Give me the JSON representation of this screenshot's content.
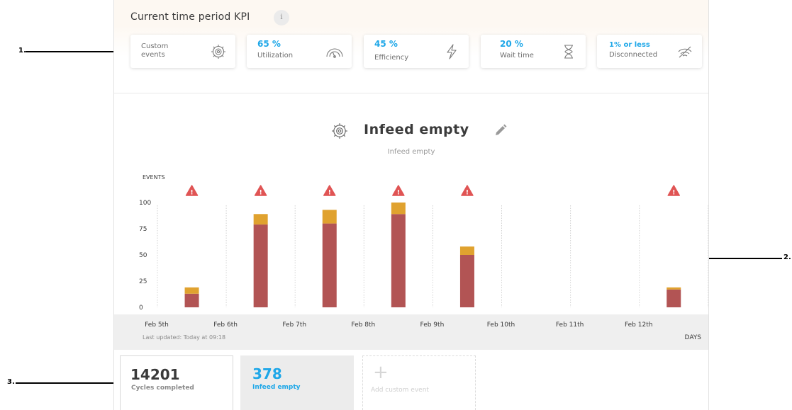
{
  "callouts": [
    "1.",
    "2.",
    "3."
  ],
  "kpi": {
    "title": "Current time period KPI",
    "info_icon": "i",
    "cards": [
      {
        "value": "",
        "label": "Custom\nevents",
        "label_line1": "Custom",
        "label_line2": "events",
        "icon": "gear-icon"
      },
      {
        "value": "65 %",
        "label": "Utilization",
        "icon": "speedometer-icon"
      },
      {
        "value": "45 %",
        "label": "Efficiency",
        "icon": "lightning-icon"
      },
      {
        "value": "20 %",
        "label": "Wait time",
        "icon": "hourglass-icon"
      },
      {
        "value": "1% or less",
        "label": "Disconnected",
        "icon": "disconnected-icon"
      }
    ]
  },
  "event": {
    "title": "Infeed empty",
    "subtitle": "Infeed empty",
    "icon": "gear-icon",
    "edit_icon": "pencil-icon"
  },
  "chart_data": {
    "type": "bar",
    "stacked": true,
    "ylabel": "EVENTS",
    "xlabel": "DAYS",
    "ylim": [
      0,
      100
    ],
    "yticks": [
      "100",
      "75",
      "50",
      "25",
      "0"
    ],
    "categories": [
      "Feb 5th",
      "Feb 6th",
      "Feb 7th",
      "Feb 8th",
      "Feb 9th",
      "Feb 10th",
      "Feb 11th",
      "Feb 12th"
    ],
    "series": [
      {
        "color": "#b25454",
        "values": [
          13,
          79,
          80,
          89,
          50,
          null,
          null,
          17
        ]
      },
      {
        "color": "#e0a22f",
        "values": [
          6,
          10,
          13,
          11,
          8,
          null,
          null,
          2
        ]
      }
    ],
    "warnings": [
      true,
      true,
      true,
      true,
      true,
      false,
      false,
      true
    ],
    "warning_color": "#e05454"
  },
  "footer": {
    "updated": "Last updated: Today at 09:18"
  },
  "stats": {
    "cycles_value": "14201",
    "cycles_label": "Cycles completed",
    "infeed_value": "378",
    "infeed_label": "Infeed empty",
    "add_plus": "+",
    "add_label": "Add custom event"
  }
}
